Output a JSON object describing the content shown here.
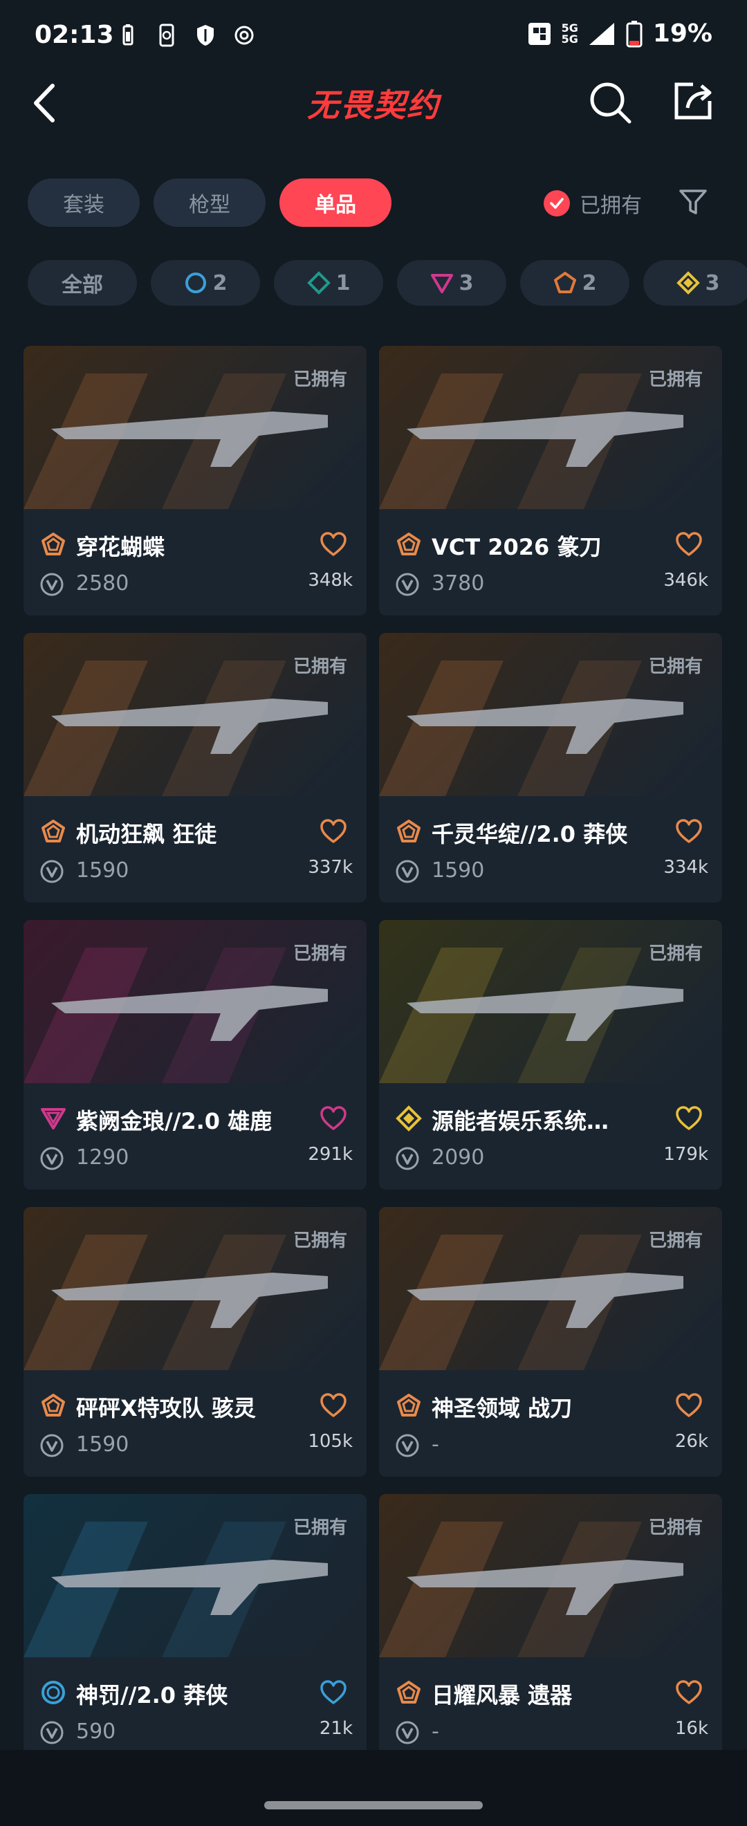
{
  "status_bar": {
    "time": "02:13",
    "network": "5G\n5G",
    "battery": "19%"
  },
  "header": {
    "title": "无畏契约"
  },
  "tabs": [
    {
      "label": "套装",
      "active": false
    },
    {
      "label": "枪型",
      "active": false
    },
    {
      "label": "单品",
      "active": true
    }
  ],
  "owned_filter": {
    "label": "已拥有",
    "checked": true
  },
  "rarity_chips": [
    {
      "label": "全部",
      "icon": "none"
    },
    {
      "label": "2",
      "icon": "select-tier-icon",
      "color": "#3aa0d8"
    },
    {
      "label": "1",
      "icon": "deluxe-tier-icon",
      "color": "#1f9a8a"
    },
    {
      "label": "3",
      "icon": "premium-tier-icon",
      "color": "#d0398c"
    },
    {
      "label": "2",
      "icon": "exclusive-tier-icon",
      "color": "#e07a3a"
    },
    {
      "label": "3",
      "icon": "ultra-tier-icon",
      "color": "#e8c23a"
    }
  ],
  "items": [
    {
      "owned": "已拥有",
      "name": "穿花蝴蝶",
      "price": "2580",
      "likes": "348k",
      "tier": "exclusive",
      "tier_color": "#e98a4a",
      "bg": "#3a2a1a"
    },
    {
      "owned": "已拥有",
      "name": "VCT 2026 篆刀",
      "price": "3780",
      "likes": "346k",
      "tier": "exclusive",
      "tier_color": "#e98a4a",
      "bg": "#3a2a1a"
    },
    {
      "owned": "已拥有",
      "name": "机动狂飙 狂徒",
      "price": "1590",
      "likes": "337k",
      "tier": "exclusive",
      "tier_color": "#e98a4a",
      "bg": "#3a2a1a"
    },
    {
      "owned": "已拥有",
      "name": "千灵华绽//2.0 莽侠",
      "price": "1590",
      "likes": "334k",
      "tier": "exclusive",
      "tier_color": "#e98a4a",
      "bg": "#3a2a1a"
    },
    {
      "owned": "已拥有",
      "name": "紫阙金琅//2.0 雄鹿",
      "price": "1290",
      "likes": "291k",
      "tier": "premium",
      "tier_color": "#d0398c",
      "bg": "#3a1a2c"
    },
    {
      "owned": "已拥有",
      "name": "源能者娱乐系统…",
      "price": "2090",
      "likes": "179k",
      "tier": "ultra",
      "tier_color": "#e8c23a",
      "bg": "#33331a"
    },
    {
      "owned": "已拥有",
      "name": "砰砰X特攻队 骇灵",
      "price": "1590",
      "likes": "105k",
      "tier": "exclusive",
      "tier_color": "#e98a4a",
      "bg": "#3a2a1a"
    },
    {
      "owned": "已拥有",
      "name": "神圣领域 战刀",
      "price": "-",
      "likes": "26k",
      "tier": "exclusive",
      "tier_color": "#e98a4a",
      "bg": "#3a2a1a"
    },
    {
      "owned": "已拥有",
      "name": "神罚//2.0 莽侠",
      "price": "590",
      "likes": "21k",
      "tier": "select",
      "tier_color": "#3aa0d8",
      "bg": "#12303f"
    },
    {
      "owned": "已拥有",
      "name": "日耀风暴 遗器",
      "price": "-",
      "likes": "16k",
      "tier": "exclusive",
      "tier_color": "#e98a4a",
      "bg": "#3a2a1a"
    }
  ]
}
